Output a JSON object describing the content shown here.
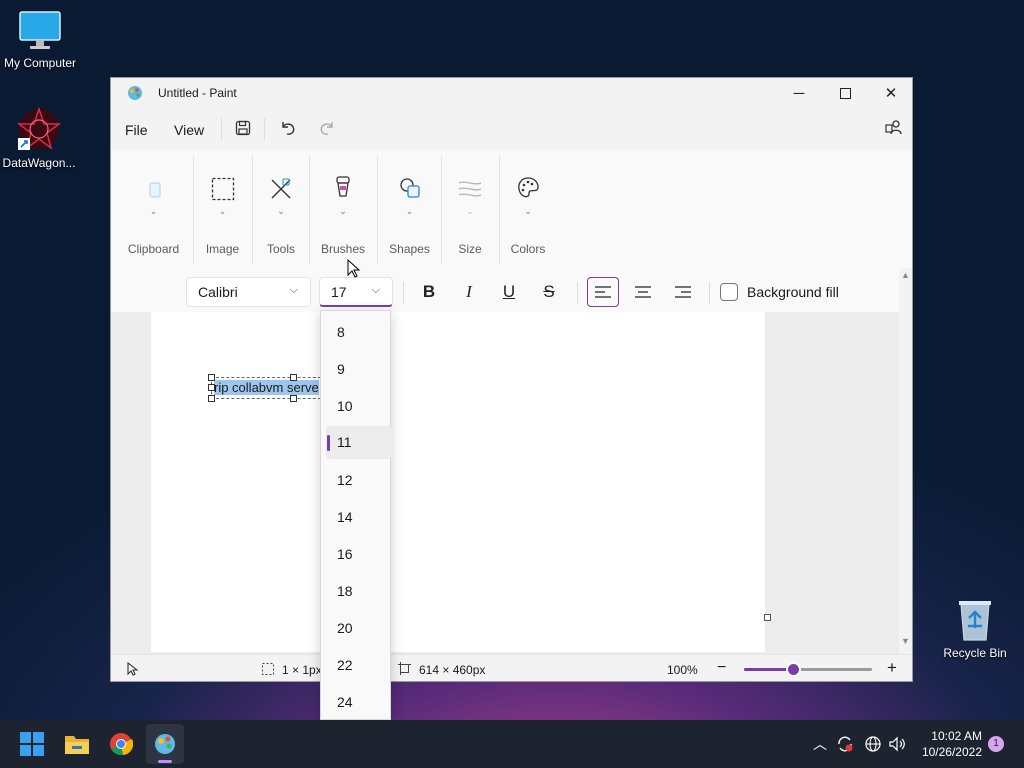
{
  "desktop": {
    "icons": [
      {
        "label": "My Computer",
        "icon": "monitor-icon"
      },
      {
        "label": "DataWagon...",
        "icon": "datawagon-icon"
      },
      {
        "label": "Recycle Bin",
        "icon": "recycle-bin-icon"
      }
    ]
  },
  "window": {
    "title": "Untitled - Paint",
    "menu": {
      "file": "File",
      "view": "View"
    }
  },
  "ribbon": {
    "groups": [
      "Clipboard",
      "Image",
      "Tools",
      "Brushes",
      "Shapes",
      "Size",
      "Colors"
    ]
  },
  "text_toolbar": {
    "font": "Calibri",
    "font_size": "17",
    "background_fill_label": "Background fill",
    "background_fill_checked": false
  },
  "canvas": {
    "text": "rip collabvm serve"
  },
  "font_size_dropdown": {
    "options": [
      "8",
      "9",
      "10",
      "11",
      "12",
      "14",
      "16",
      "18",
      "20",
      "22",
      "24"
    ],
    "selected": "11"
  },
  "status": {
    "selection_size": "1 × 1px",
    "canvas_size": "614 × 460px",
    "zoom": "100%"
  },
  "taskbar": {
    "time": "10:02 AM",
    "date": "10/26/2022",
    "notifications": "1"
  },
  "colors": {
    "accent": "#7a3caa",
    "selection_highlight": "#9dc6ef"
  }
}
